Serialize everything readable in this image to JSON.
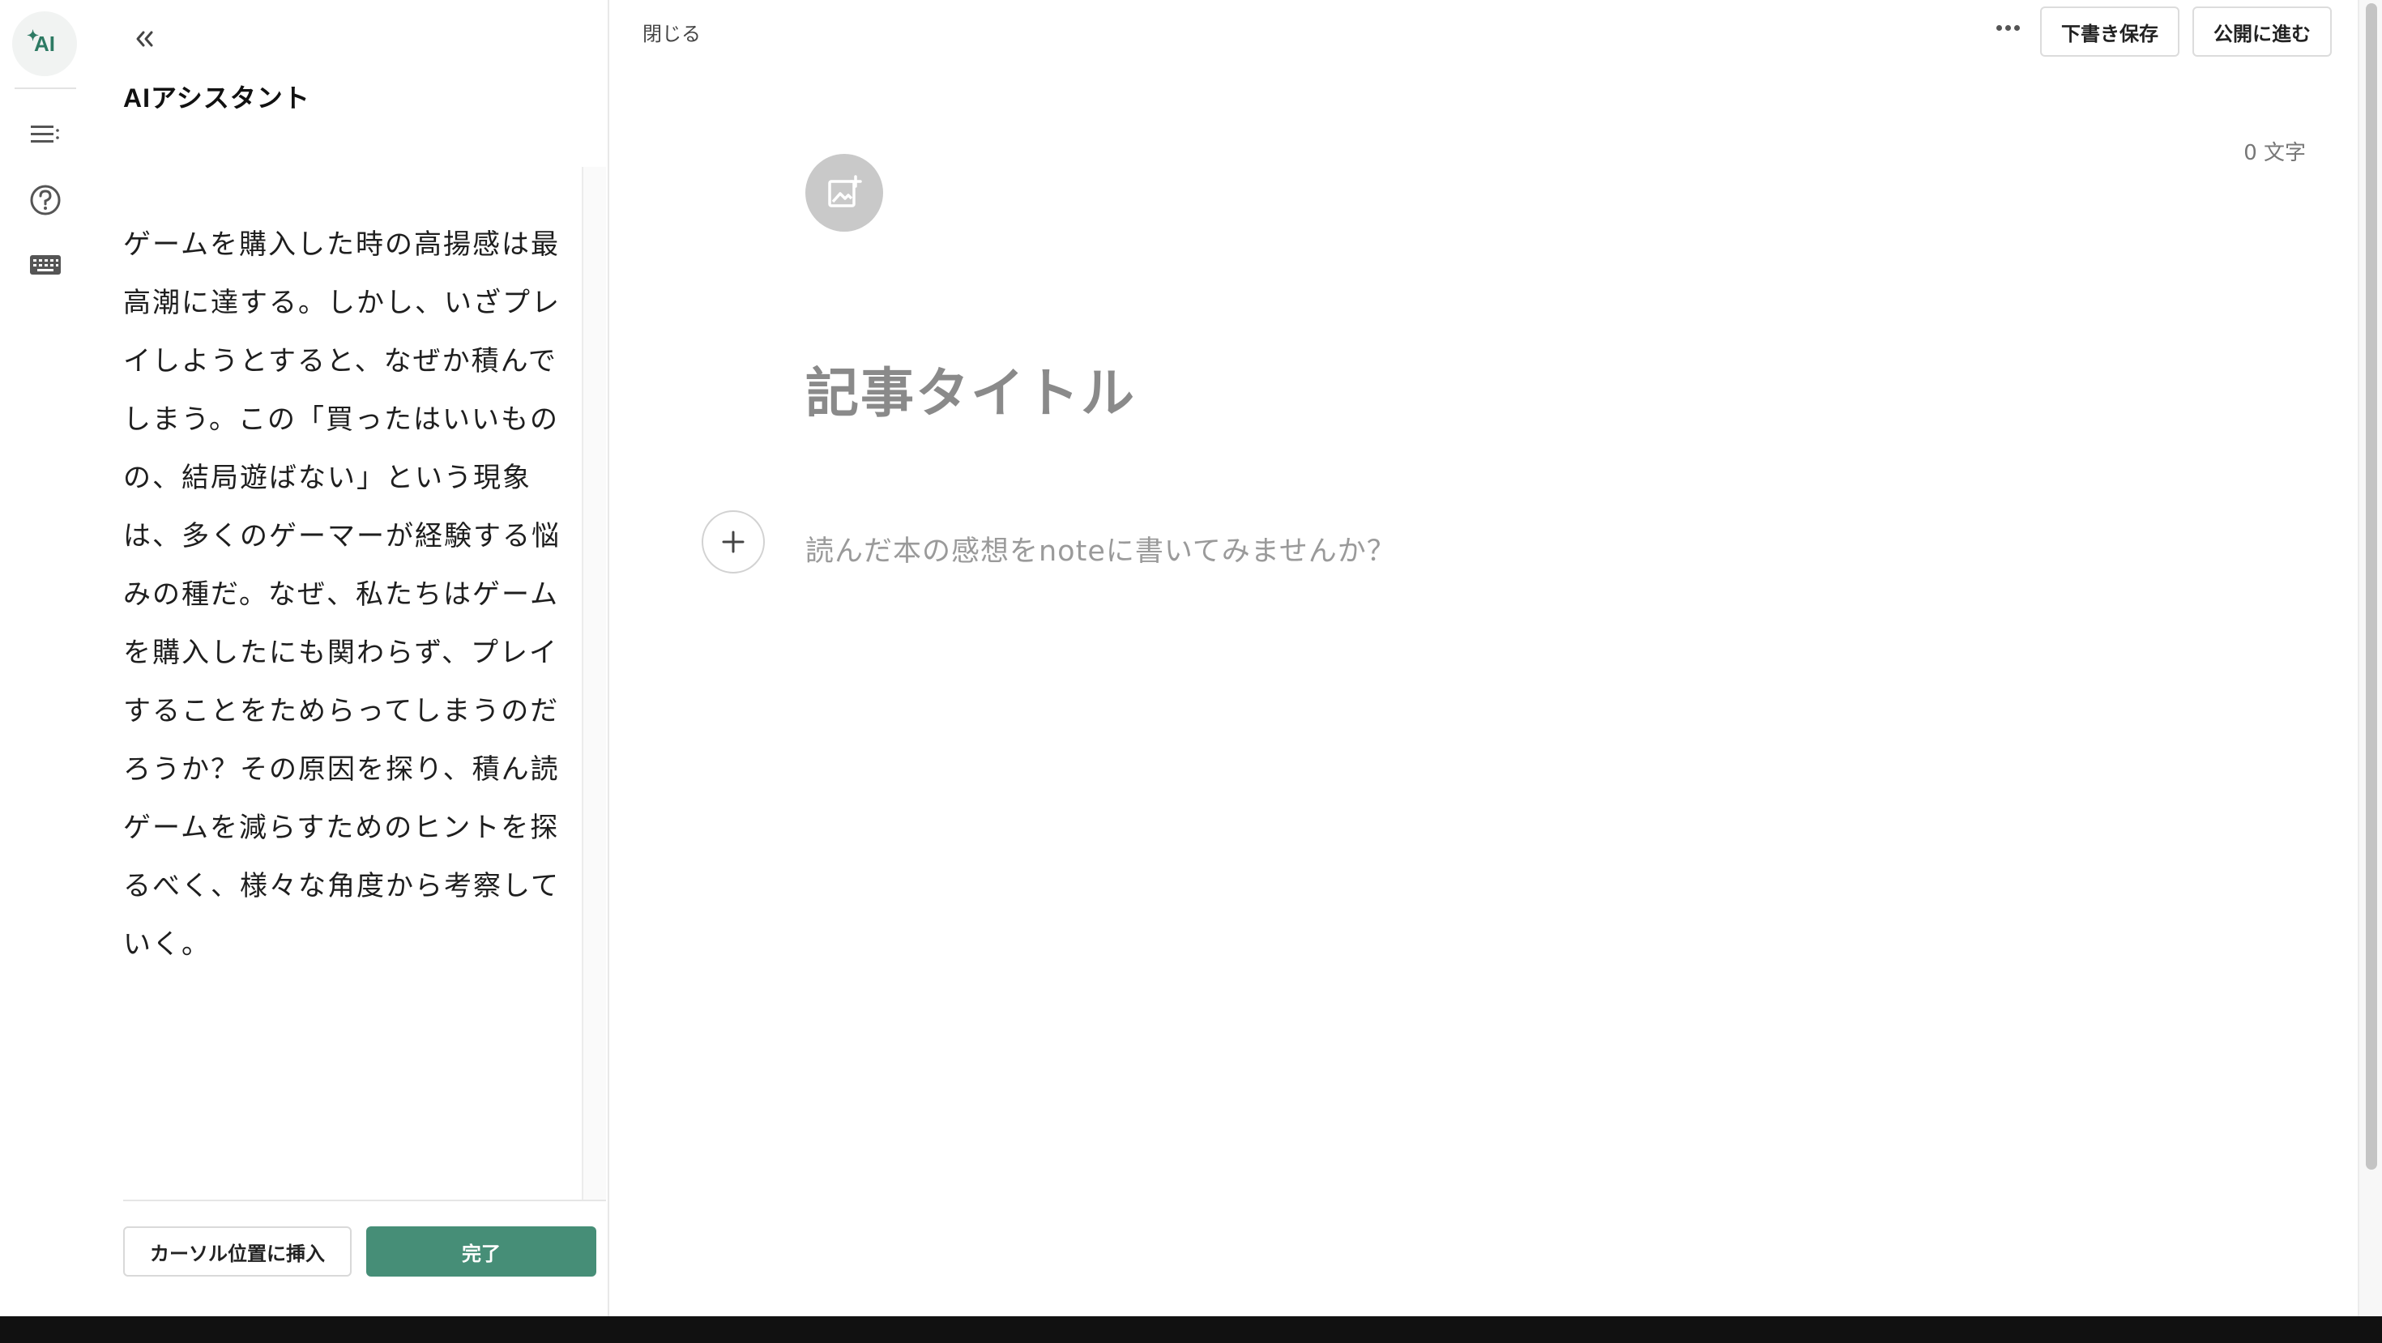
{
  "rail": {
    "ai_label": "AI",
    "icons": [
      "ai-assistant-icon",
      "table-of-contents-icon",
      "help-icon",
      "keyboard-icon"
    ]
  },
  "assistant": {
    "title": "AIアシスタント",
    "generated_text": "ゲームを購入した時の高揚感は最高潮に達する。しかし、いざプレイしようとすると、なぜか積んでしまう。この「買ったはいいものの、結局遊ばない」という現象は、多くのゲーマーが経験する悩みの種だ。なぜ、私たちはゲームを購入したにも関わらず、プレイすることをためらってしまうのだろうか？その原因を探り、積ん読ゲームを減らすためのヒントを探るべく、様々な角度から考察していく。",
    "insert_label": "カーソル位置に挿入",
    "done_label": "完了"
  },
  "editor": {
    "close_label": "閉じる",
    "save_label": "下書き保存",
    "publish_label": "公開に進む",
    "char_count": "0 文字",
    "title_placeholder": "記事タイトル",
    "body_placeholder": "読んだ本の感想をnoteに書いてみませんか？"
  },
  "colors": {
    "accent": "#468e77",
    "placeholder": "#8a8a8a"
  }
}
